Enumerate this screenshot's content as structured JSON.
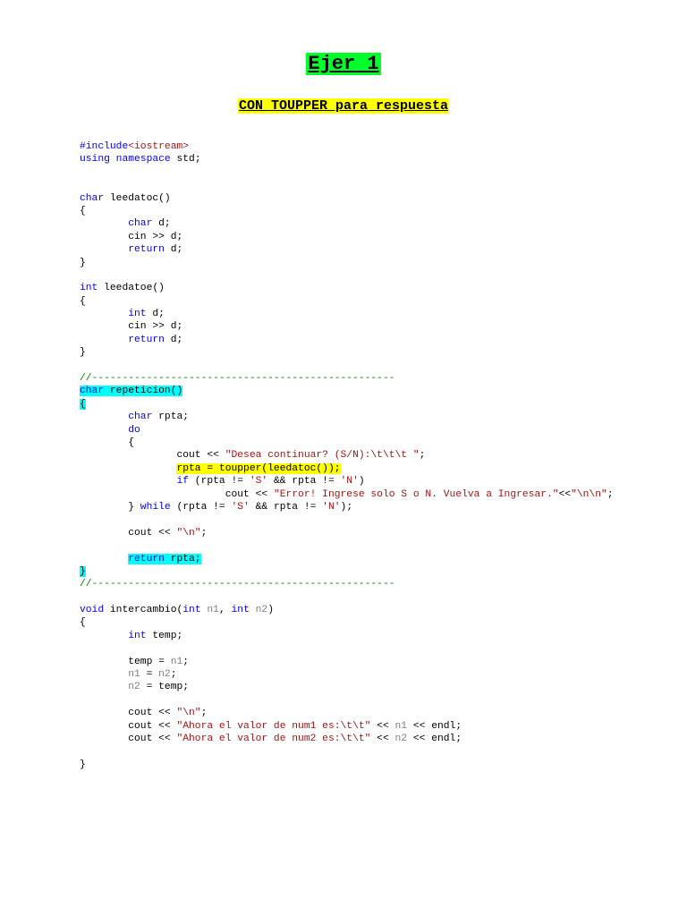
{
  "heading": "Ejer 1",
  "subheading": "CON TOUPPER para respuesta",
  "code_lines": [
    [
      {
        "t": "#include",
        "c": "kw"
      },
      {
        "t": "<iostream>",
        "c": "st"
      }
    ],
    [
      {
        "t": "using namespace",
        "c": "kw"
      },
      {
        "t": " std;"
      }
    ],
    [],
    [],
    [
      {
        "t": "char",
        "c": "kw"
      },
      {
        "t": " leedatoc()"
      }
    ],
    [
      {
        "t": "{"
      }
    ],
    [
      {
        "t": "        "
      },
      {
        "t": "char",
        "c": "kw"
      },
      {
        "t": " d;"
      }
    ],
    [
      {
        "t": "        cin >> d;"
      }
    ],
    [
      {
        "t": "        "
      },
      {
        "t": "return",
        "c": "kw"
      },
      {
        "t": " d;"
      }
    ],
    [
      {
        "t": "}"
      }
    ],
    [],
    [
      {
        "t": "int",
        "c": "kw"
      },
      {
        "t": " leedatoe()"
      }
    ],
    [
      {
        "t": "{"
      }
    ],
    [
      {
        "t": "        "
      },
      {
        "t": "int",
        "c": "kw"
      },
      {
        "t": " d;"
      }
    ],
    [
      {
        "t": "        cin >> d;"
      }
    ],
    [
      {
        "t": "        "
      },
      {
        "t": "return",
        "c": "kw"
      },
      {
        "t": " d;"
      }
    ],
    [
      {
        "t": "}"
      }
    ],
    [],
    [
      {
        "t": "//--------------------------------------------------",
        "c": "cm"
      }
    ],
    [
      {
        "t": "char",
        "c": "kw hl-cyan"
      },
      {
        "t": " repeticion()",
        "c": "hl-cyan"
      }
    ],
    [
      {
        "t": "{",
        "c": "hl-cyan"
      }
    ],
    [
      {
        "t": "        "
      },
      {
        "t": "char",
        "c": "kw"
      },
      {
        "t": " rpta;"
      }
    ],
    [
      {
        "t": "        "
      },
      {
        "t": "do",
        "c": "kw"
      }
    ],
    [
      {
        "t": "        {"
      }
    ],
    [
      {
        "t": "                cout << "
      },
      {
        "t": "\"Desea continuar? (S/N):\\t\\t\\t \"",
        "c": "st"
      },
      {
        "t": ";"
      }
    ],
    [
      {
        "t": "                "
      },
      {
        "t": "rpta = toupper(leedatoc());",
        "c": "hl-yel"
      }
    ],
    [
      {
        "t": "                "
      },
      {
        "t": "if",
        "c": "kw"
      },
      {
        "t": " (rpta != "
      },
      {
        "t": "'S'",
        "c": "st"
      },
      {
        "t": " && rpta != "
      },
      {
        "t": "'N'",
        "c": "st"
      },
      {
        "t": ")"
      }
    ],
    [
      {
        "t": "                        cout << "
      },
      {
        "t": "\"Error! Ingrese solo S o N. Vuelva a Ingresar.\"",
        "c": "st"
      },
      {
        "t": "<<"
      },
      {
        "t": "\"\\n\\n\"",
        "c": "st"
      },
      {
        "t": ";"
      }
    ],
    [
      {
        "t": "        } "
      },
      {
        "t": "while",
        "c": "kw"
      },
      {
        "t": " (rpta != "
      },
      {
        "t": "'S'",
        "c": "st"
      },
      {
        "t": " && rpta != "
      },
      {
        "t": "'N'",
        "c": "st"
      },
      {
        "t": ");"
      }
    ],
    [],
    [
      {
        "t": "        cout << "
      },
      {
        "t": "\"\\n\"",
        "c": "st"
      },
      {
        "t": ";"
      }
    ],
    [],
    [
      {
        "t": "        "
      },
      {
        "t": "return",
        "c": "kw hl-cyan"
      },
      {
        "t": " rpta;",
        "c": "hl-cyan"
      }
    ],
    [
      {
        "t": "}",
        "c": "hl-cyan"
      }
    ],
    [
      {
        "t": "//--------------------------------------------------",
        "c": "cm"
      }
    ],
    [],
    [
      {
        "t": "void",
        "c": "kw"
      },
      {
        "t": " intercambio("
      },
      {
        "t": "int",
        "c": "kw"
      },
      {
        "t": " "
      },
      {
        "t": "n1",
        "c": "pp"
      },
      {
        "t": ", "
      },
      {
        "t": "int",
        "c": "kw"
      },
      {
        "t": " "
      },
      {
        "t": "n2",
        "c": "pp"
      },
      {
        "t": ")"
      }
    ],
    [
      {
        "t": "{"
      }
    ],
    [
      {
        "t": "        "
      },
      {
        "t": "int",
        "c": "kw"
      },
      {
        "t": " temp;"
      }
    ],
    [],
    [
      {
        "t": "        temp = "
      },
      {
        "t": "n1",
        "c": "pp"
      },
      {
        "t": ";"
      }
    ],
    [
      {
        "t": "        "
      },
      {
        "t": "n1",
        "c": "pp"
      },
      {
        "t": " = "
      },
      {
        "t": "n2",
        "c": "pp"
      },
      {
        "t": ";"
      }
    ],
    [
      {
        "t": "        "
      },
      {
        "t": "n2",
        "c": "pp"
      },
      {
        "t": " = temp;"
      }
    ],
    [],
    [
      {
        "t": "        cout << "
      },
      {
        "t": "\"\\n\"",
        "c": "st"
      },
      {
        "t": ";"
      }
    ],
    [
      {
        "t": "        cout << "
      },
      {
        "t": "\"Ahora el valor de num1 es:\\t\\t\"",
        "c": "st"
      },
      {
        "t": " << "
      },
      {
        "t": "n1",
        "c": "pp"
      },
      {
        "t": " << endl;"
      }
    ],
    [
      {
        "t": "        cout << "
      },
      {
        "t": "\"Ahora el valor de num2 es:\\t\\t\"",
        "c": "st"
      },
      {
        "t": " << "
      },
      {
        "t": "n2",
        "c": "pp"
      },
      {
        "t": " << endl;"
      }
    ],
    [],
    [
      {
        "t": "}"
      }
    ]
  ]
}
